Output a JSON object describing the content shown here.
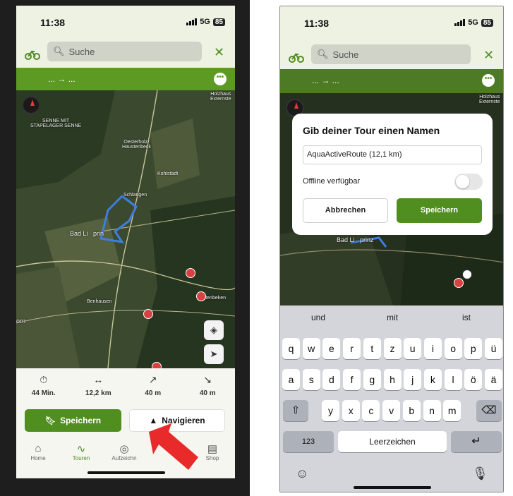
{
  "left_phone": {
    "status": {
      "time": "11:38",
      "network": "5G",
      "battery": "85"
    },
    "search": {
      "placeholder": "Suche"
    },
    "route_bar": {
      "label": "... → ..."
    },
    "map": {
      "labels": {
        "senne": "SENNE MIT\nSTAPELAGER SENNE",
        "oesterholz": "Oesterholz-\nHaustenbeck",
        "kohlstadt": "Kohlstädt",
        "schlangen": "Schlangen",
        "bad_lipp": "Bad Li   prin",
        "benhausen": "Benhausen",
        "altenbeken": "Altenbeken",
        "born": "orn",
        "holzhausen": "Holzhaus\nExternste"
      }
    },
    "stats": [
      {
        "icon": "timer-icon",
        "glyph": "⏱",
        "value": "44 Min."
      },
      {
        "icon": "distance-icon",
        "glyph": "↔",
        "value": "12,2 km"
      },
      {
        "icon": "ascent-icon",
        "glyph": "↗",
        "value": "40 m"
      },
      {
        "icon": "descent-icon",
        "glyph": "↘",
        "value": "40 m"
      }
    ],
    "actions": {
      "save": "Speichern",
      "navigate": "Navigieren"
    },
    "tabs": [
      {
        "label": "Home",
        "glyph": "⌂"
      },
      {
        "label": "Touren",
        "glyph": "∿"
      },
      {
        "label": "Aufzeichn",
        "glyph": "◎"
      },
      {
        "label": "Shop",
        "glyph": "▤"
      }
    ]
  },
  "right_phone": {
    "status": {
      "time": "11:38",
      "network": "5G",
      "battery": "85"
    },
    "search": {
      "placeholder": "Suche"
    },
    "route_bar": {
      "label": "... → ..."
    },
    "map": {
      "labels": {
        "bad_lipp": "Bad Li   prinz",
        "holzhausen": "Holzhaus\nExternste"
      }
    },
    "dialog": {
      "title": "Gib deiner Tour einen Namen",
      "input_value": "AquaActiveRoute (12,1 km)",
      "offline_label": "Offline verfügbar",
      "offline_enabled": false,
      "cancel": "Abbrechen",
      "save": "Speichern"
    },
    "keyboard": {
      "suggestions": [
        "und",
        "mit",
        "ist"
      ],
      "row1": [
        "q",
        "w",
        "e",
        "r",
        "t",
        "z",
        "u",
        "i",
        "o",
        "p",
        "ü"
      ],
      "row2": [
        "a",
        "s",
        "d",
        "f",
        "g",
        "h",
        "j",
        "k",
        "l",
        "ö",
        "ä"
      ],
      "row3": [
        "y",
        "x",
        "c",
        "v",
        "b",
        "n",
        "m"
      ],
      "numbers_key": "123",
      "space_key": "Leerzeichen"
    }
  },
  "colors": {
    "brand_green": "#5c9a23",
    "save_green": "#4f8e1f",
    "annotation_red": "#e82a2a",
    "poi_red": "#d84141"
  }
}
